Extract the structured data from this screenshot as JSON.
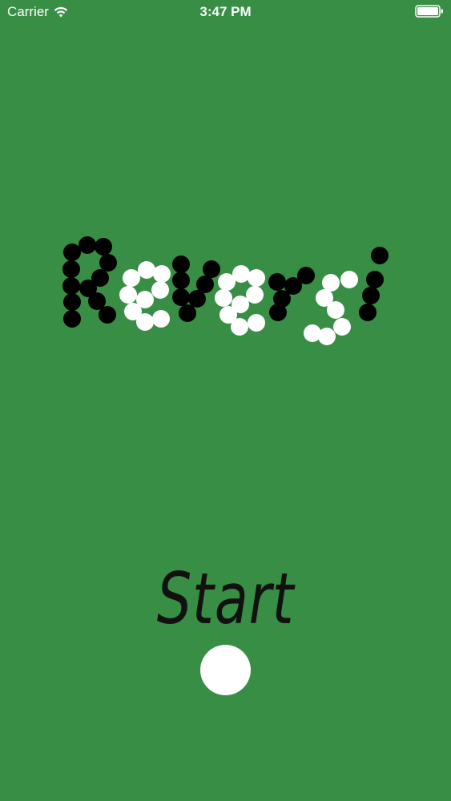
{
  "status_bar": {
    "carrier": "Carrier",
    "time": "3:47 PM",
    "wifi_icon": "wifi-icon",
    "battery_icon": "battery-icon"
  },
  "logo": {
    "word": "Reversi",
    "disc_colors": {
      "black": "#000000",
      "white": "#ffffff"
    }
  },
  "start": {
    "label": "Start",
    "button_icon": "white-disc"
  },
  "colors": {
    "background": "#378E44",
    "text": "#111111"
  }
}
